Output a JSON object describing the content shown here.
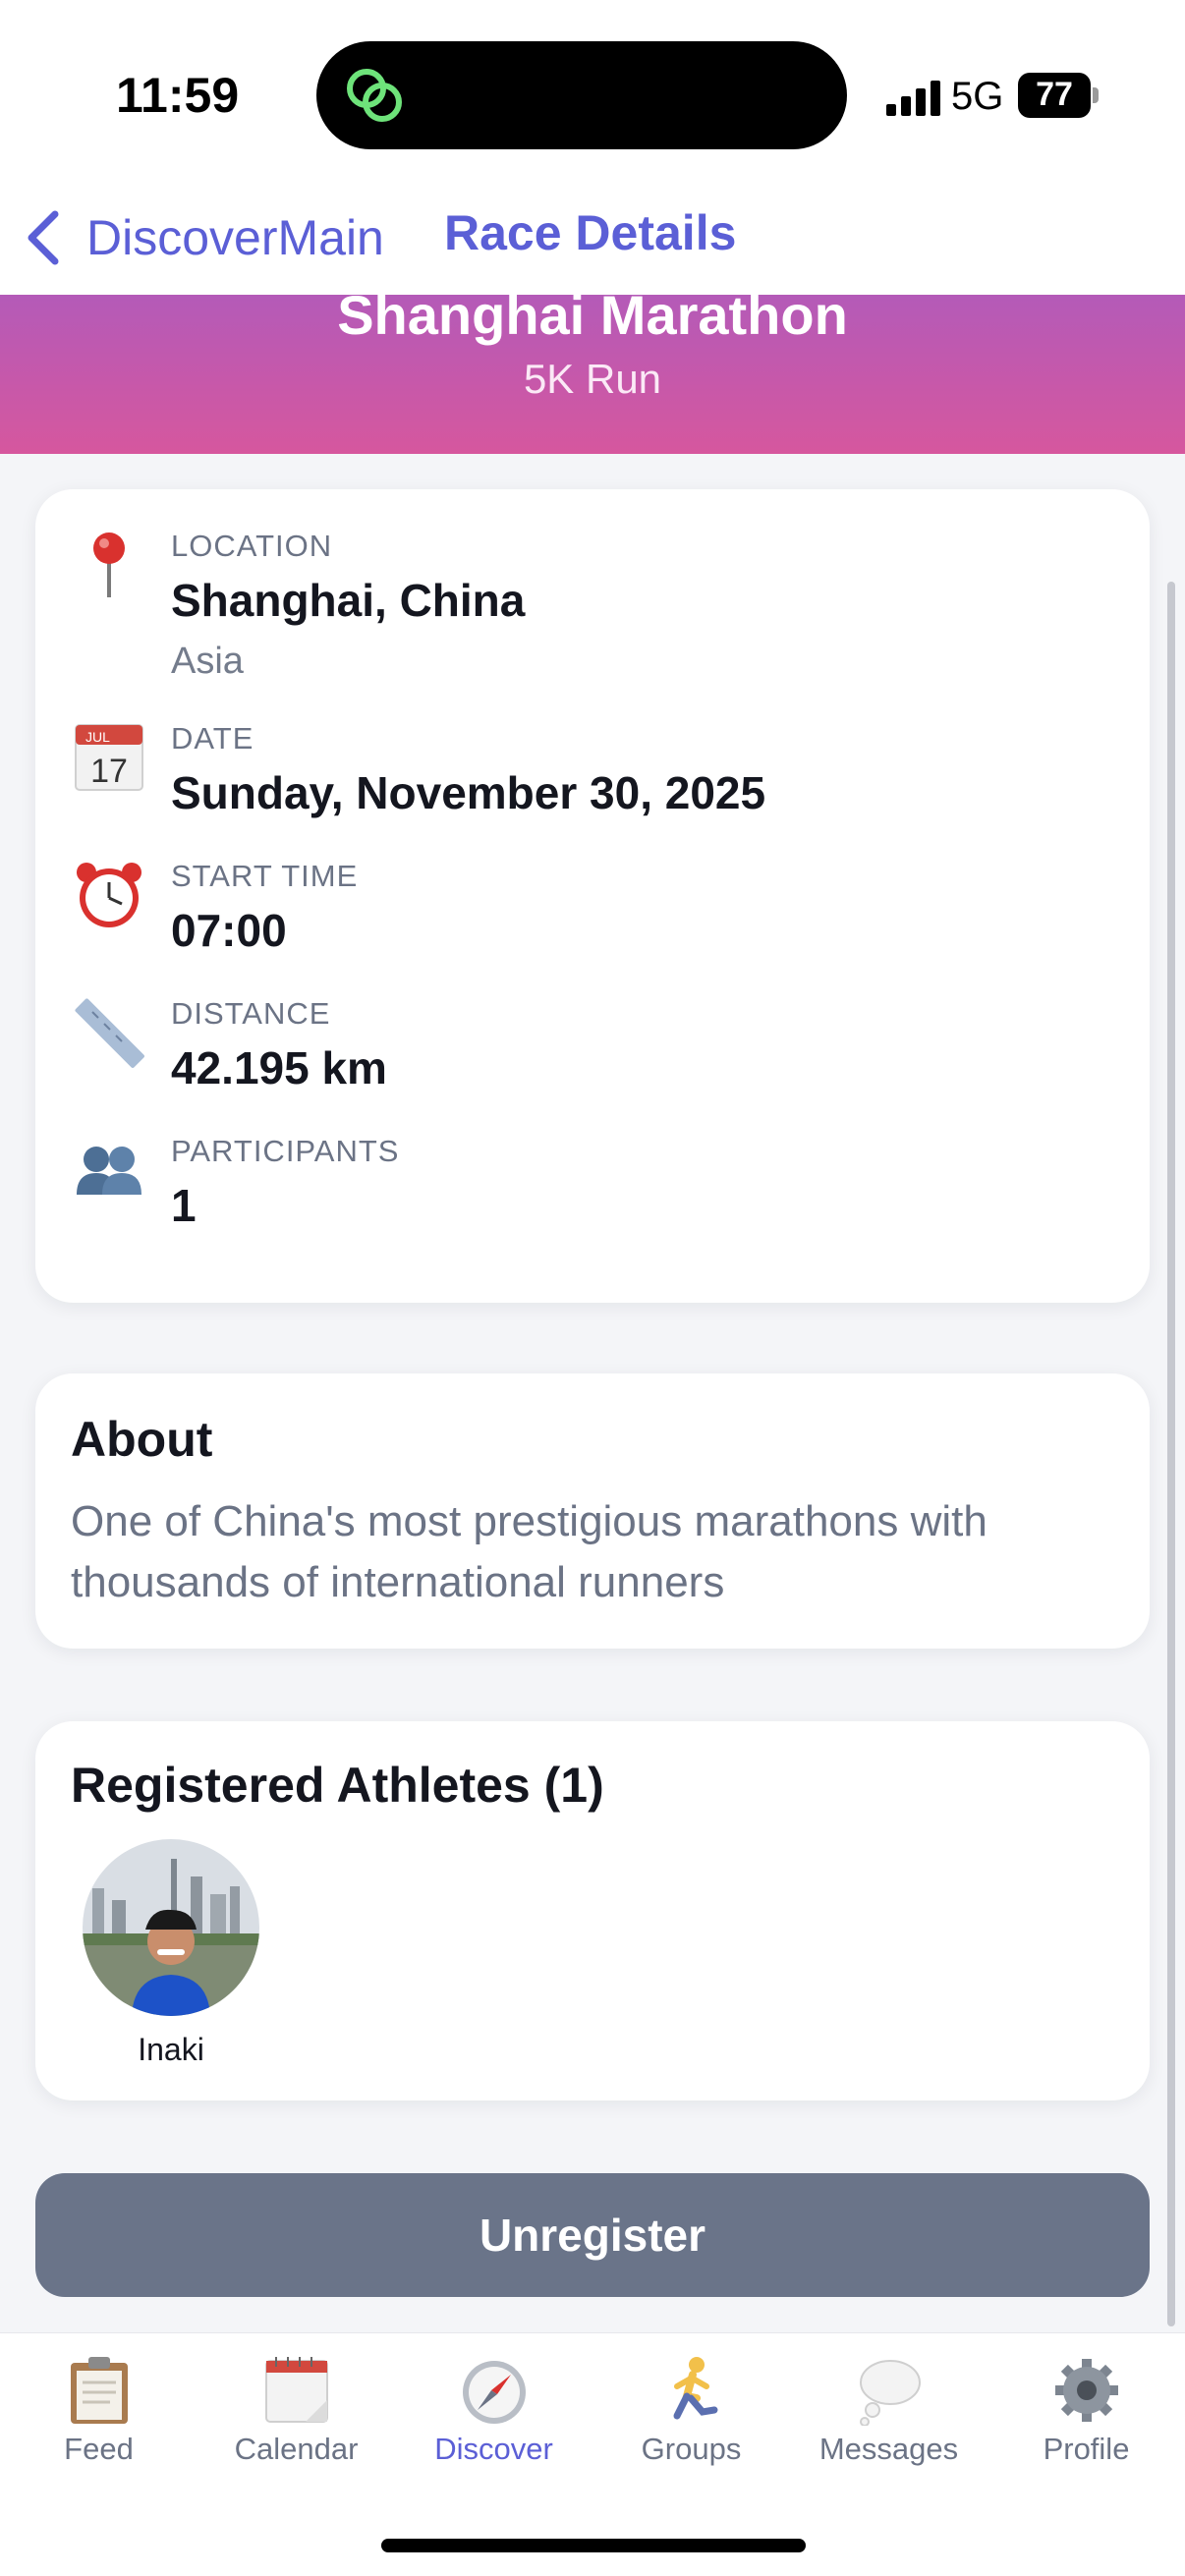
{
  "status_bar": {
    "time": "11:59",
    "network": "5G",
    "battery": "77"
  },
  "nav": {
    "back_label": "DiscoverMain",
    "title": "Race Details"
  },
  "hero": {
    "title": "Shanghai Marathon",
    "subtitle": "5K Run"
  },
  "details": {
    "location": {
      "label": "LOCATION",
      "value": "Shanghai, China",
      "sub": "Asia",
      "icon": "pushpin-icon"
    },
    "date": {
      "label": "DATE",
      "value": "Sunday, November 30, 2025",
      "icon": "calendar-icon",
      "icon_month": "JUL",
      "icon_day": "17"
    },
    "start_time": {
      "label": "START TIME",
      "value": "07:00",
      "icon": "alarm-clock-icon"
    },
    "distance": {
      "label": "DISTANCE",
      "value": "42.195 km",
      "icon": "ruler-icon"
    },
    "participants": {
      "label": "PARTICIPANTS",
      "value": "1",
      "icon": "people-icon"
    }
  },
  "about": {
    "title": "About",
    "text": "One of China's most prestigious marathons with thousands of international runners"
  },
  "athletes": {
    "title": "Registered Athletes (1)",
    "list": [
      {
        "name": "Inaki"
      }
    ]
  },
  "actions": {
    "unregister_label": "Unregister"
  },
  "tabs": [
    {
      "label": "Feed",
      "icon": "clipboard-icon"
    },
    {
      "label": "Calendar",
      "icon": "calendar-icon"
    },
    {
      "label": "Discover",
      "icon": "compass-icon",
      "active": true
    },
    {
      "label": "Groups",
      "icon": "runner-icon"
    },
    {
      "label": "Messages",
      "icon": "thought-bubble-icon"
    },
    {
      "label": "Profile",
      "icon": "gear-icon"
    }
  ],
  "colors": {
    "accent": "#5b5fd6",
    "hero_top": "#b45ab8",
    "hero_bottom": "#d6579e",
    "button": "#6a7489"
  }
}
